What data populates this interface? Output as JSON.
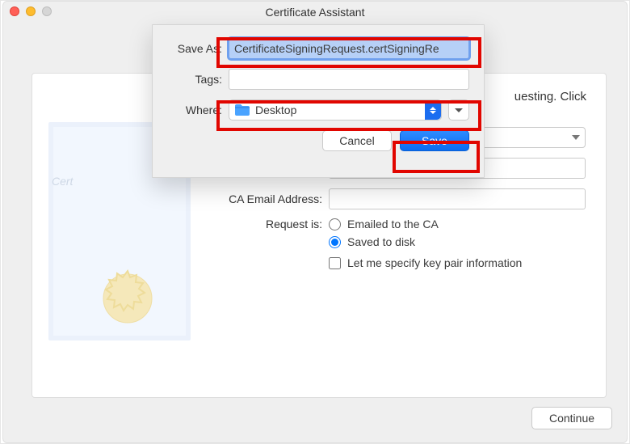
{
  "window": {
    "title": "Certificate Assistant"
  },
  "sheet": {
    "saveAs": {
      "label": "Save As:",
      "value": "CertificateSigningRequest.certSigningRe"
    },
    "tags": {
      "label": "Tags:",
      "value": ""
    },
    "where": {
      "label": "Where:",
      "value": "Desktop"
    },
    "cancel": "Cancel",
    "save": "Save"
  },
  "panel": {
    "hint_fragment": "uesting. Click",
    "caEmail": {
      "label": "CA Email Address:",
      "value": ""
    },
    "requestIs": {
      "label": "Request is:",
      "opt_email": "Emailed to the CA",
      "opt_disk": "Saved to disk",
      "selected": "opt_disk",
      "specify": "Let me specify key pair information"
    },
    "continue": "Continue"
  }
}
